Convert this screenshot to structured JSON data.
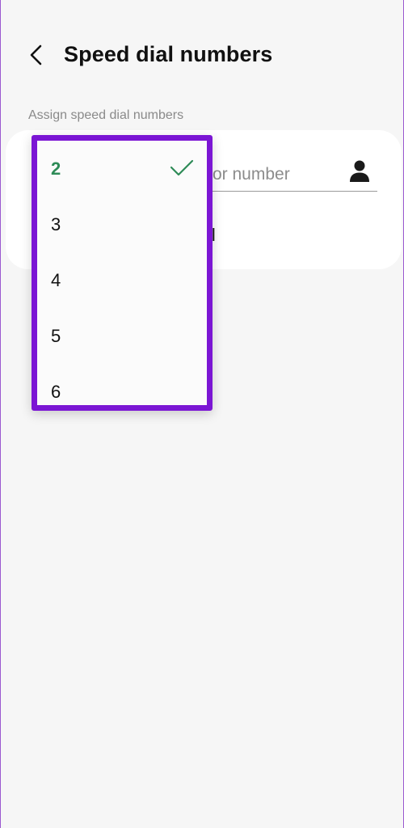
{
  "header": {
    "title": "Speed dial numbers",
    "back_icon": "chevron-left-icon"
  },
  "section": {
    "label": "Assign speed dial numbers"
  },
  "card": {
    "number_placeholder_visible": "or number",
    "partial_text": "il",
    "contact_icon": "person-icon"
  },
  "dropdown": {
    "options": [
      "2",
      "3",
      "4",
      "5",
      "6"
    ],
    "selected": "2",
    "selected_color": "#2e8b57",
    "highlight_border_color": "#7b16d4",
    "check_icon": "check-icon"
  }
}
